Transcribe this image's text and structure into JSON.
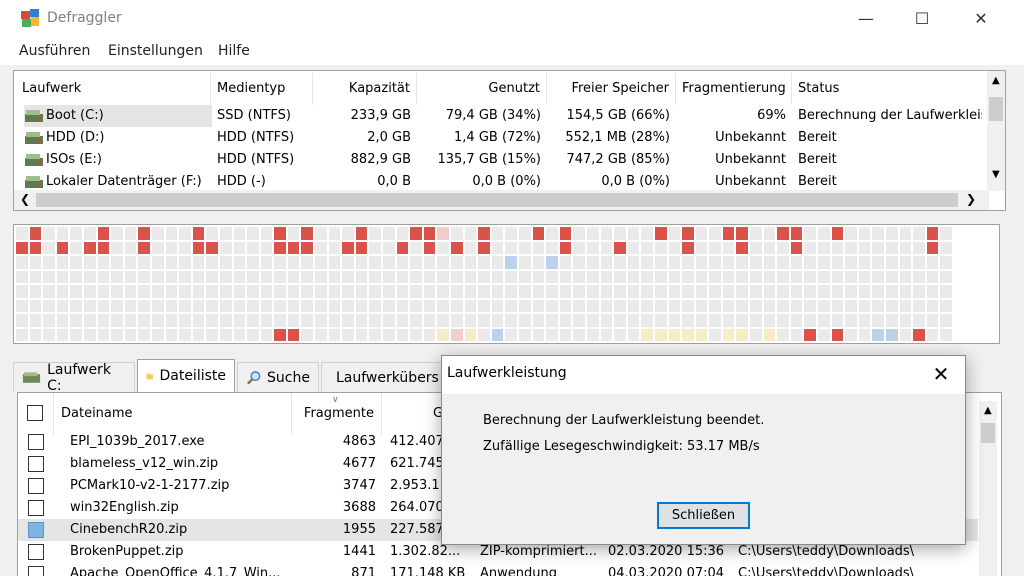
{
  "window": {
    "title": "Defraggler"
  },
  "menu": [
    "Ausführen",
    "Einstellungen",
    "Hilfe"
  ],
  "drives": {
    "columns": [
      "Laufwerk",
      "Medientyp",
      "Kapazität",
      "Genutzt",
      "Freier Speicher",
      "Fragmentierung",
      "Status"
    ],
    "rows": [
      {
        "name": "Boot (C:)",
        "media": "SSD (NTFS)",
        "capacity": "233,9 GB",
        "used": "79,4 GB (34%)",
        "free": "154,5 GB (66%)",
        "frag": "69%",
        "status": "Berechnung der Laufwerkleist"
      },
      {
        "name": "HDD (D:)",
        "media": "HDD (NTFS)",
        "capacity": "2,0 GB",
        "used": "1,4 GB (72%)",
        "free": "552,1 MB (28%)",
        "frag": "Unbekannt",
        "status": "Bereit"
      },
      {
        "name": "ISOs (E:)",
        "media": "HDD (NTFS)",
        "capacity": "882,9 GB",
        "used": "135,7 GB (15%)",
        "free": "747,2 GB (85%)",
        "frag": "Unbekannt",
        "status": "Bereit"
      },
      {
        "name": "Lokaler Datenträger (F:)",
        "media": "HDD (-)",
        "capacity": "0,0 B",
        "used": "0,0 B (0%)",
        "free": "0,0 B (0%)",
        "frag": "Unbekannt",
        "status": "Bereit"
      }
    ]
  },
  "map": {
    "rows": 8,
    "cols": 69,
    "legend": {
      "f": "#d9534a",
      "p": "#f3cccc",
      "b": "#bcd1ee",
      "y": "#f7ecc8",
      "e": "#eaeaea"
    },
    "cells": [
      "ef...efe.fe..fe....f.fe.ef...ffp..fe.ef.f..eeeefef..ffeeff.ef.eee.ef.ff",
      "ff.f.ff..fe..ffe...fffe.ff..fef.fef....ef...fe...f..efe..fe.e...e..fef",
      "....................................b..b.........................e.....",
      "......................................................................",
      "......................................................................",
      "......................................................................",
      "......................................................................",
      "...................ff..........ypy.b..........yyyyy.yy.y..f.f..bb.f..ff"
    ]
  },
  "tabs": [
    {
      "label": "Laufwerk C:",
      "icon": "drive-icon"
    },
    {
      "label": "Dateiliste",
      "icon": "folder-icon"
    },
    {
      "label": "Suche",
      "icon": "search-icon"
    },
    {
      "label": "Laufwerkübers",
      "icon": "chart-icon"
    }
  ],
  "files": {
    "columns": [
      "Dateiname",
      "Fragmente",
      "Gr"
    ],
    "rows": [
      {
        "name": "EPI_1039b_2017.exe",
        "frags": "4863",
        "size": "412.407",
        "type": "",
        "date": "",
        "path": "",
        "checked": false
      },
      {
        "name": "blameless_v12_win.zip",
        "frags": "4677",
        "size": "621.745",
        "type": "",
        "date": "",
        "path": "",
        "checked": false
      },
      {
        "name": "PCMark10-v2-1-2177.zip",
        "frags": "3747",
        "size": "2.953.1",
        "type": "",
        "date": "",
        "path": "",
        "checked": false
      },
      {
        "name": "win32English.zip",
        "frags": "3688",
        "size": "264.070",
        "type": "",
        "date": "",
        "path": "",
        "checked": false
      },
      {
        "name": "CinebenchR20.zip",
        "frags": "1955",
        "size": "227.587",
        "type": "",
        "date": "",
        "path": "",
        "checked": true
      },
      {
        "name": "BrokenPuppet.zip",
        "frags": "1441",
        "size": "1.302.82...",
        "type": "ZIP-komprimiert...",
        "date": "02.03.2020 15:36",
        "path": "C:\\Users\\teddy\\Downloads\\",
        "checked": false
      },
      {
        "name": "Apache_OpenOffice_4.1.7_Win...",
        "frags": "871",
        "size": "171.148 KB",
        "type": "Anwendung",
        "date": "04.03.2020 07:04",
        "path": "C:\\Users\\teddy\\Downloads\\",
        "checked": false
      }
    ]
  },
  "dialog": {
    "title": "Laufwerkleistung",
    "message": "Berechnung der Laufwerkleistung beendet.",
    "speed": "Zufällige Lesegeschwindigkeit: 53.17 MB/s",
    "button": "Schließen"
  }
}
